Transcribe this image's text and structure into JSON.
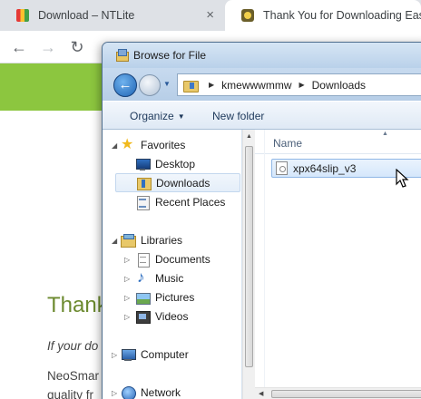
{
  "browser": {
    "tabs": [
      {
        "title": "Download – NTLite",
        "close": "×"
      },
      {
        "title": "Thank You for Downloading Easy"
      }
    ],
    "nav": {
      "back": "←",
      "forward": "→",
      "reload": "↻"
    }
  },
  "webpage": {
    "heading": "Thank",
    "intro": "If your do",
    "body_line1": "NeoSmar",
    "body_line2": "quality fr",
    "accent_color": "#8cc63f"
  },
  "dialog": {
    "title": "Browse for File",
    "breadcrumb": [
      "kmewwwmmw",
      "Downloads"
    ],
    "commands": {
      "organize": "Organize",
      "new_folder": "New folder"
    },
    "nav_tree": {
      "favorites": {
        "label": "Favorites",
        "items": [
          "Desktop",
          "Downloads",
          "Recent Places"
        ],
        "selected": "Downloads"
      },
      "libraries": {
        "label": "Libraries",
        "items": [
          "Documents",
          "Music",
          "Pictures",
          "Videos"
        ]
      },
      "computer": "Computer",
      "network": "Network"
    },
    "file_list": {
      "column_name": "Name",
      "files": [
        "xpx64slip_v3"
      ],
      "selected": "xpx64slip_v3"
    }
  }
}
